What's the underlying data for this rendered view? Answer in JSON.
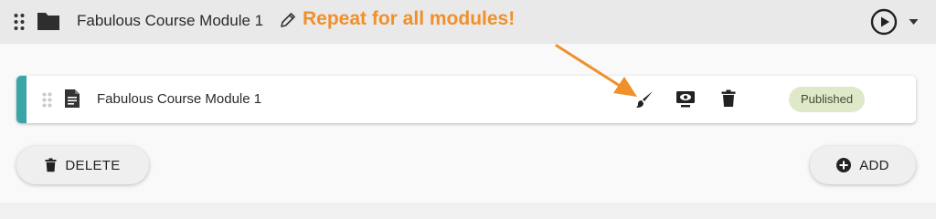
{
  "header": {
    "module_title": "Fabulous Course Module 1",
    "annotation": "Repeat for all modules!",
    "icons": [
      "drag-handle-icon",
      "folder-icon",
      "pencil-icon",
      "play-circle-icon",
      "caret-down-icon"
    ]
  },
  "item": {
    "title": "Fabulous Course Module 1",
    "status": "Published",
    "accent_color": "#3aa5a7",
    "icons": [
      "drag-handle-icon",
      "document-icon",
      "paintbrush-icon",
      "preview-icon",
      "trash-icon"
    ]
  },
  "buttons": {
    "delete_label": "DELETE",
    "add_label": "ADD"
  },
  "colors": {
    "annotation": "#f0902a",
    "badge_bg": "#dfe9c9",
    "header_bg": "#e9e9ea"
  }
}
